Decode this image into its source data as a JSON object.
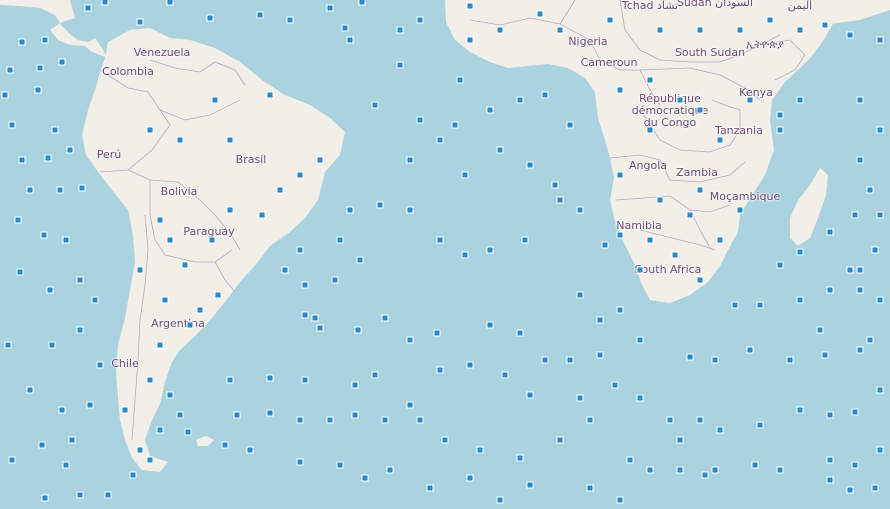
{
  "map": {
    "country_labels": [
      {
        "key": "chad",
        "text": "Tchad تشاد"
      },
      {
        "key": "sudan",
        "text": "Sudan السودان"
      },
      {
        "key": "yemen",
        "text": "اليمن"
      },
      {
        "key": "venezuela",
        "text": "Venezuela"
      },
      {
        "key": "colombia",
        "text": "Colombia"
      },
      {
        "key": "nigeria",
        "text": "Nigeria"
      },
      {
        "key": "south_sudan",
        "text": "South Sudan"
      },
      {
        "key": "ethiopia",
        "text": "ኢትዮጵያ"
      },
      {
        "key": "cameroun",
        "text": "Cameroun"
      },
      {
        "key": "rdc",
        "text": "République démocratique du Congo"
      },
      {
        "key": "kenya",
        "text": "Kenya"
      },
      {
        "key": "peru",
        "text": "Perú"
      },
      {
        "key": "brasil",
        "text": "Brasil"
      },
      {
        "key": "tanzania",
        "text": "Tanzania"
      },
      {
        "key": "angola",
        "text": "Angola"
      },
      {
        "key": "zambia",
        "text": "Zambia"
      },
      {
        "key": "bolivia",
        "text": "Bolivia"
      },
      {
        "key": "mozambique",
        "text": "Moçambique"
      },
      {
        "key": "paraguay",
        "text": "Paraguay"
      },
      {
        "key": "namibia",
        "text": "Namibia"
      },
      {
        "key": "south_africa",
        "text": "South Africa"
      },
      {
        "key": "argentina",
        "text": "Argentina"
      },
      {
        "key": "chile",
        "text": "Chile"
      }
    ],
    "colors": {
      "water": "#aad3df",
      "land": "#f2efe9",
      "border": "#b9a8c6",
      "marker": "#2a88c8",
      "label": "#6b4a72"
    },
    "marker_icon": "square-marker-icon"
  }
}
